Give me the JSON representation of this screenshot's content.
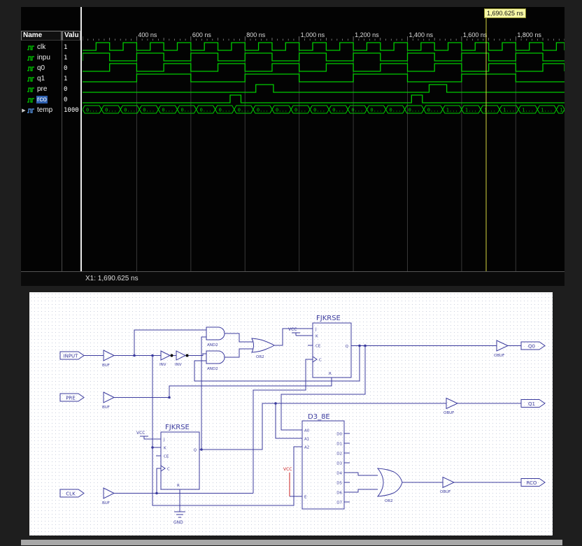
{
  "colors": {
    "wave_green": "#00cc00",
    "cursor_yellow": "#d6d640",
    "grid": "#383838",
    "selection_blue": "#2d5fae",
    "schematic_ink": "#3b3b9e",
    "vcc_red": "#cc2222"
  },
  "waveform_panel": {
    "cursor_label": "1,690.625 ns",
    "status": "X1: 1,690.625 ns",
    "headers": {
      "name": "Name",
      "value": "Valu"
    },
    "timeline": {
      "t_start": 200,
      "t_end": 1980,
      "ticks": [
        400,
        600,
        800,
        1000,
        1200,
        1400,
        1600,
        1800
      ],
      "tick_labels": [
        "400 ns",
        "600 ns",
        "800 ns",
        "1,000 ns",
        "1,200 ns",
        "1,400 ns",
        "1,600 ns",
        "1,800 ns"
      ]
    },
    "cursor_t": 1690.625,
    "signals": [
      {
        "name": "clk",
        "value": "1",
        "type": "bit",
        "wave": {
          "kind": "clock",
          "rise": 250,
          "period": 100,
          "high": 50
        }
      },
      {
        "name": "inpu",
        "value": "1",
        "type": "bit",
        "wave": {
          "kind": "clock",
          "rise": 200,
          "period": 200,
          "high": 100
        }
      },
      {
        "name": "q0",
        "value": "0",
        "type": "bit",
        "wave": {
          "kind": "clock",
          "rise": 300,
          "period": 200,
          "high": 100
        }
      },
      {
        "name": "q1",
        "value": "1",
        "type": "bit",
        "wave": {
          "kind": "clock",
          "rise": 400,
          "period": 400,
          "high": 200
        }
      },
      {
        "name": "pre",
        "value": "0",
        "type": "bit",
        "wave": {
          "kind": "pulses",
          "pulses": [
            [
              840,
              905
            ],
            [
              1480,
              1545
            ]
          ]
        }
      },
      {
        "name": "rco",
        "value": "0",
        "type": "bit",
        "selected": true,
        "wave": {
          "kind": "pulses",
          "pulses": [
            [
              745,
              785
            ],
            [
              1415,
              1455
            ]
          ]
        }
      },
      {
        "name": "temp",
        "value": "1000",
        "type": "bus",
        "expand": true,
        "wave": {
          "kind": "bus",
          "step": 70,
          "change_at": 1480,
          "label_before": "0...",
          "label_after": "1..."
        }
      }
    ]
  },
  "schematic": {
    "ff_top": "FJKRSE",
    "ff_bottom": "FJKRSE",
    "decoder": "D3_8E",
    "and": "AND2",
    "or_top": "OR2",
    "or_out": "OR2",
    "inv": "INV",
    "buf": "BUF",
    "obuf": "OBUF",
    "vcc": "VCC",
    "gnd": "GND",
    "ports": {
      "input": "INPUT",
      "pre": "PRE",
      "clk": "CLK",
      "q0": "Q0",
      "q1": "Q1",
      "rco": "RCO"
    },
    "ff_pins": {
      "j": "J",
      "k": "K",
      "ce": "CE",
      "c": "C",
      "r": "R",
      "q": "Q"
    },
    "decoder_pins": {
      "a0": "A0",
      "a1": "A1",
      "a2": "A2",
      "e": "E",
      "d": [
        "D0",
        "D1",
        "D2",
        "D3",
        "D4",
        "D5",
        "D6",
        "D7"
      ]
    }
  }
}
